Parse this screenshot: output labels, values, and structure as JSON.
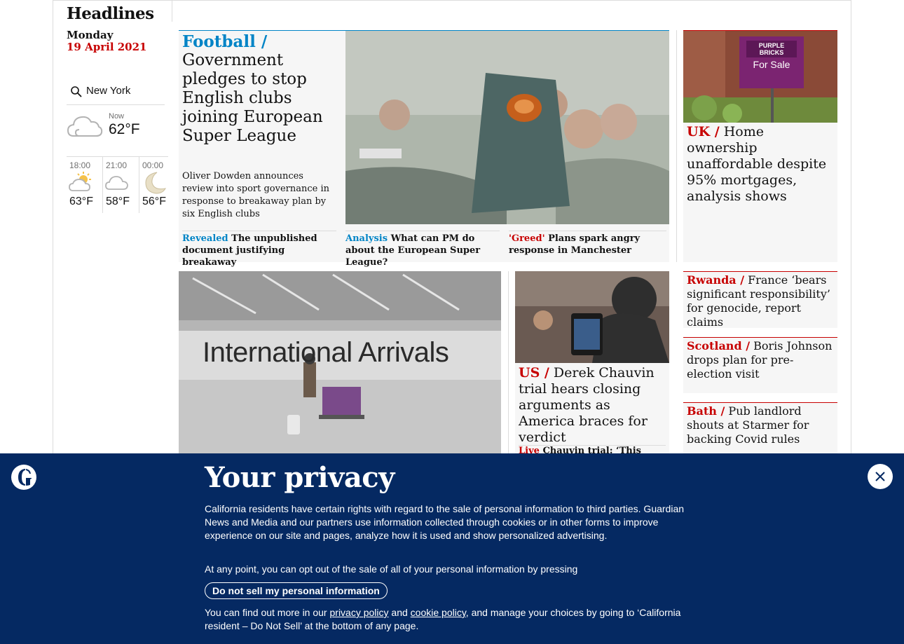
{
  "section": {
    "title": "Headlines",
    "day": "Monday",
    "date": "19 April 2021"
  },
  "weather": {
    "search_icon": "search-icon",
    "location": "New York",
    "now_label": "Now",
    "now_temp": "62°F",
    "now_icon": "cloud-icon",
    "forecast": [
      {
        "time": "18:00",
        "temp": "63°F",
        "icon": "sun-cloud-icon"
      },
      {
        "time": "21:00",
        "temp": "58°F",
        "icon": "cloud-icon"
      },
      {
        "time": "00:00",
        "temp": "56°F",
        "icon": "moon-icon"
      }
    ]
  },
  "lead": {
    "kicker": "Football /",
    "headline": "Government pledges to stop English clubs joining European Super League",
    "standfirst": "Oliver Dowden announces review into sport governance in response to breakaway plan by six English clubs",
    "sublinks": [
      {
        "kicker": "Revealed",
        "text": "The unpublished document justifying breakaway"
      },
      {
        "kicker": "Analysis",
        "text": "What can PM do about the European Super League?"
      },
      {
        "kicker": "'Greed'",
        "text": "Plans spark angry response in Manchester"
      }
    ]
  },
  "uk_card": {
    "kicker": "UK /",
    "headline": "Home ownership unaffordable despite 95% mortgages, analysis shows",
    "sign_brand": "PURPLE BRICKS",
    "sign_text": "For Sale"
  },
  "side_cards": [
    {
      "kicker": "Rwanda /",
      "headline": "France ‘bears significant responsibility’ for genocide, report claims"
    },
    {
      "kicker": "Scotland /",
      "headline": "Boris Johnson drops plan for pre-election visit"
    },
    {
      "kicker": "Bath /",
      "headline": "Pub landlord shouts at Starmer for backing Covid rules"
    }
  ],
  "arrivals_card": {
    "sign_text": "International Arrivals"
  },
  "us_card": {
    "kicker": "US /",
    "headline": "Derek Chauvin trial hears closing arguments as America braces for verdict",
    "live_kicker": "Live",
    "live_text": "Chauvin trial: ‘This wasn’t"
  },
  "privacy": {
    "title": "Your privacy",
    "body": "California residents have certain rights with regard to the sale of personal information to third parties. Guardian News and Media and our partners use information collected through cookies or in other forms to improve experience on our site and pages, analyze how it is used and show personalized advertising.",
    "optout_text": "At any point, you can opt out of the sale of all of your personal information by pressing",
    "dns_button": "Do not sell my personal information",
    "more_prefix": "You can find out more in our",
    "privacy_policy_link": "privacy policy",
    "and": "and",
    "cookie_policy_link": "cookie policy",
    "more_suffix": ", and manage your choices by going to ‘California resident – Do Not Sell’ at the bottom of any page.",
    "close_icon": "close-icon",
    "logo": "guardian-logo-icon"
  },
  "colors": {
    "accent_blue": "#0084c6",
    "news_red": "#c70000",
    "brand_navy": "#052962",
    "panel_bg": "#f6f6f6"
  }
}
